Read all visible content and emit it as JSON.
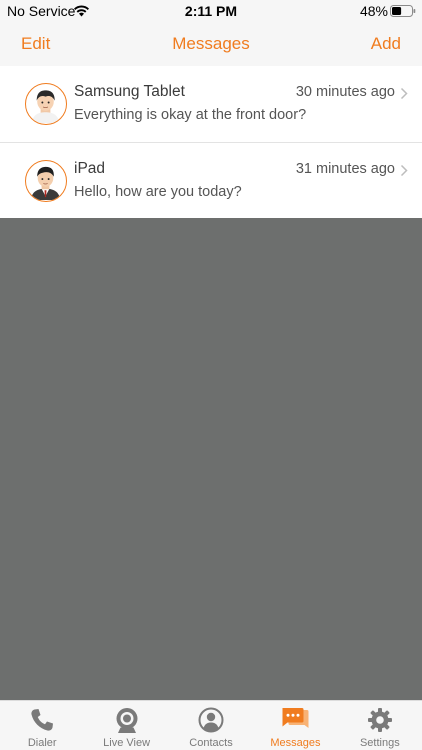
{
  "status": {
    "carrier": "No Service",
    "time": "2:11 PM",
    "battery_percent": "48%",
    "battery_level": 0.48
  },
  "nav": {
    "left": "Edit",
    "title": "Messages",
    "right": "Add"
  },
  "messages": [
    {
      "name": "Samsung Tablet",
      "time": "30 minutes ago",
      "preview": "Everything is okay at the front door?"
    },
    {
      "name": "iPad",
      "time": "31 minutes ago",
      "preview": "Hello, how are you today?"
    }
  ],
  "tabs": [
    {
      "label": "Dialer",
      "icon": "phone-icon"
    },
    {
      "label": "Live View",
      "icon": "webcam-icon"
    },
    {
      "label": "Contacts",
      "icon": "person-icon"
    },
    {
      "label": "Messages",
      "icon": "chat-bubbles-icon",
      "active": true
    },
    {
      "label": "Settings",
      "icon": "gear-icon"
    }
  ],
  "colors": {
    "accent": "#f07c1f",
    "tab_inactive": "#7a7a7a",
    "overlay": "#6d6f6e"
  }
}
